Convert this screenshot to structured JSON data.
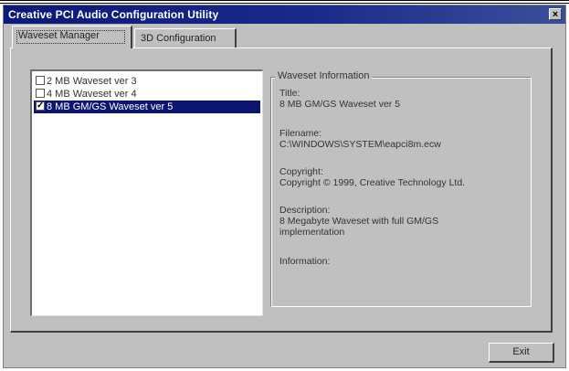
{
  "window": {
    "title": "Creative PCI Audio Configuration Utility",
    "close_label": "×"
  },
  "tabs": [
    {
      "label": "Waveset Manager"
    },
    {
      "label": "3D Configuration"
    }
  ],
  "waveset_list": {
    "items": [
      {
        "label": "2 MB Waveset ver 3",
        "checked": false,
        "selected": false
      },
      {
        "label": "4 MB Waveset ver 4",
        "checked": false,
        "selected": false
      },
      {
        "label": "8 MB GM/GS Waveset ver 5",
        "checked": true,
        "selected": true
      }
    ]
  },
  "waveset_info": {
    "group_title": "Waveset Information",
    "title_label": "Title:",
    "title_value": "8 MB GM/GS Waveset ver 5",
    "filename_label": "Filename:",
    "filename_value": "C:\\WINDOWS\\SYSTEM\\eapci8m.ecw",
    "copyright_label": "Copyright:",
    "copyright_value": "Copyright © 1999, Creative Technology Ltd.",
    "description_label": "Description:",
    "description_value_line1": "8 Megabyte Waveset with full GM/GS",
    "description_value_line2": "implementation",
    "information_label": "Information:"
  },
  "buttons": {
    "exit_label": "Exit"
  },
  "colors": {
    "titlebar": "#0a1a78",
    "selection": "#0c1570",
    "dialog": "#c0c0c0"
  }
}
